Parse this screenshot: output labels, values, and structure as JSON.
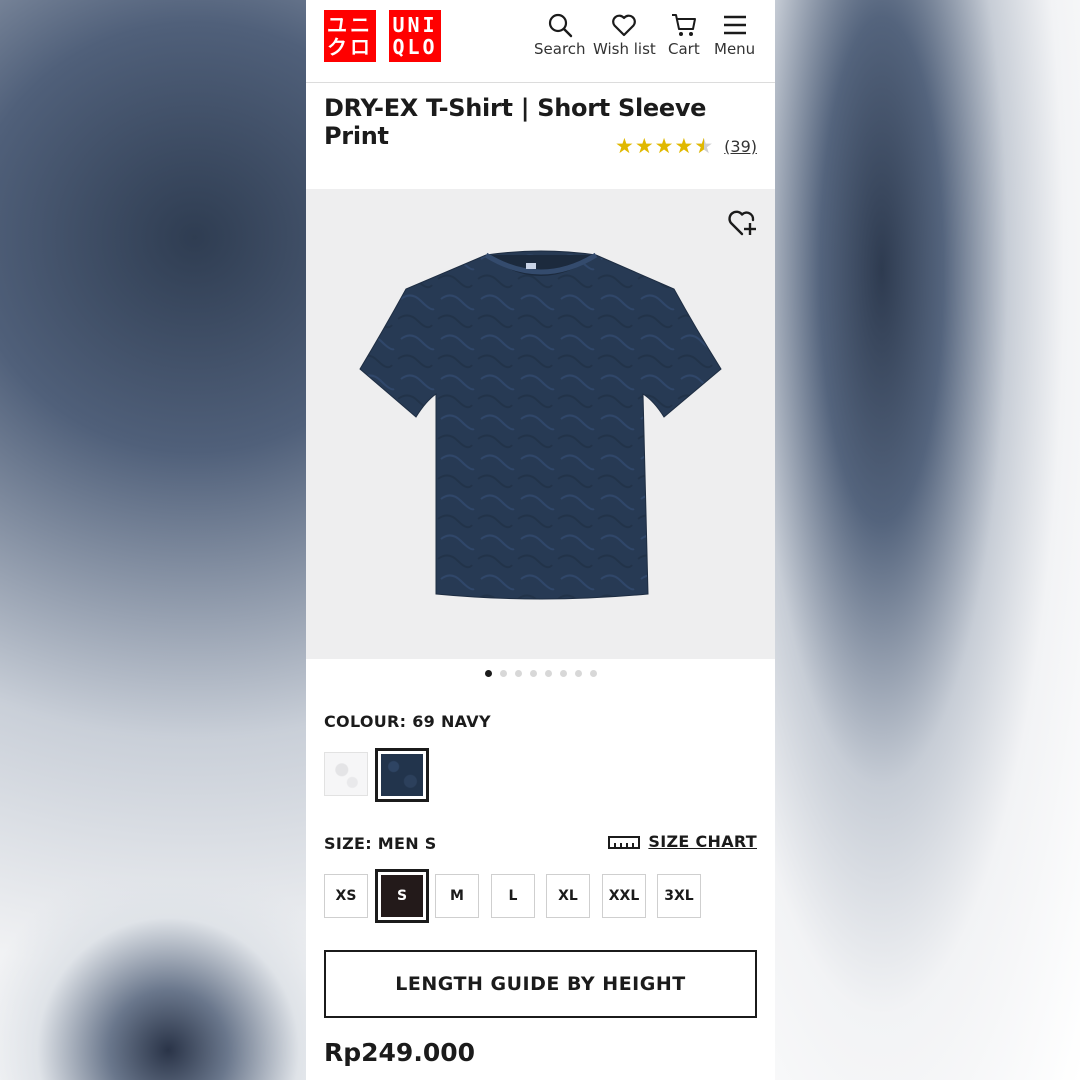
{
  "header": {
    "logo_jp": "ユニ\nクロ",
    "logo_en": "UNI\nQLO",
    "nav": {
      "search": "Search",
      "wishlist": "Wish list",
      "cart": "Cart",
      "menu": "Menu"
    }
  },
  "product": {
    "title": "DRY-EX T-Shirt | Short Sleeve Print",
    "rating": 4.5,
    "stars": "★★★★",
    "half_star": "★",
    "review_count": "(39)",
    "image_count": 8,
    "active_image": 1,
    "price": "Rp249.000"
  },
  "colour": {
    "label": "COLOUR: 69 NAVY",
    "options": [
      "white",
      "navy"
    ],
    "selected": "navy"
  },
  "size": {
    "label": "SIZE: MEN S",
    "chart_label": "SIZE CHART",
    "options": [
      "XS",
      "S",
      "M",
      "L",
      "XL",
      "XXL",
      "3XL"
    ],
    "selected": "S"
  },
  "length_guide_label": "LENGTH GUIDE BY HEIGHT",
  "colors": {
    "brand": "#ff0000",
    "star": "#e0b800",
    "navy": "#22344c"
  }
}
